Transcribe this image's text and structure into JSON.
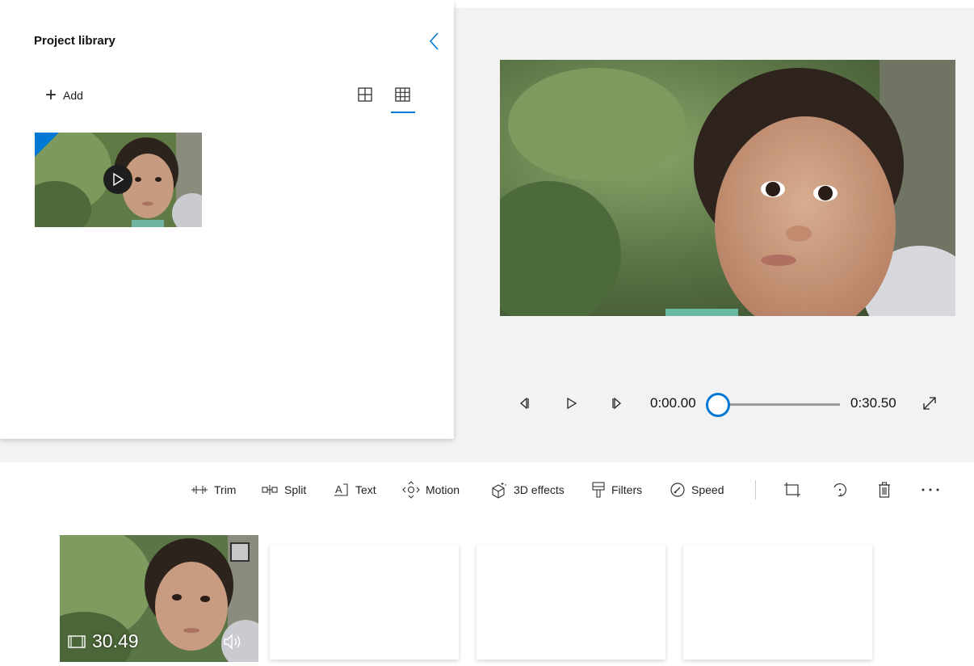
{
  "library": {
    "title": "Project library",
    "add_label": "Add"
  },
  "player": {
    "current_time": "0:00.00",
    "total_time": "0:30.50",
    "progress": 0
  },
  "toolbar": {
    "trim": "Trim",
    "split": "Split",
    "text": "Text",
    "motion": "Motion",
    "effects3d": "3D effects",
    "filters": "Filters",
    "speed": "Speed"
  },
  "storyboard": {
    "clip_duration": "30.49"
  },
  "colors": {
    "accent": "#0078d4",
    "panel_bg": "#f2f2f2"
  }
}
